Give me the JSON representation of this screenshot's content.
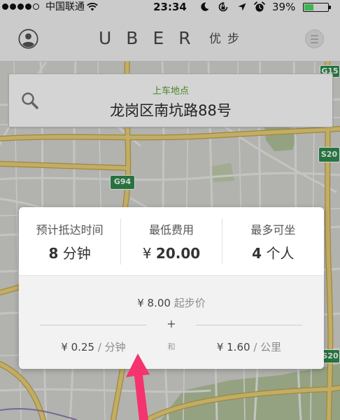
{
  "status_bar": {
    "signal": {
      "filled": 4,
      "total": 5
    },
    "carrier": "中国联通",
    "time": "23:34",
    "battery_text": "39%",
    "battery_level": 0.39,
    "icons": [
      "wifi-icon",
      "moon-icon",
      "rotation-lock-icon",
      "location-arrow-icon",
      "alarm-clock-icon",
      "battery-icon"
    ]
  },
  "nav": {
    "logo": "UBER",
    "logo_cn": "优步",
    "icons": [
      "account-icon",
      "menu-icon"
    ]
  },
  "map": {
    "shields": [
      "G15",
      "S20",
      "G94",
      "S20"
    ]
  },
  "pickup": {
    "label": "上车地点",
    "address": "龙岗区南坑路88号",
    "icon": "search-icon"
  },
  "fare_card": {
    "stats": [
      {
        "label": "预计抵达时间",
        "value": "8",
        "unit": "分钟"
      },
      {
        "label": "最低费用",
        "prefix": "¥",
        "value": "20.00"
      },
      {
        "label": "最多可坐",
        "value": "4",
        "unit": "个人"
      }
    ],
    "base_fare": {
      "amount": "¥ 8.00",
      "label": "起步价"
    },
    "plus": "+",
    "per_minute": {
      "amount": "¥ 0.25",
      "unit": "/ 分钟"
    },
    "and": "和",
    "per_km": {
      "amount": "¥ 1.60",
      "unit": "/ 公里"
    }
  },
  "annotation": {
    "icon": "pink-arrow-icon"
  },
  "colors": {
    "pickup_label": "#5a9f2e",
    "arrow": "#f5336e",
    "battery_fill": "#4cd964",
    "highway_shield": "#2e8b4e",
    "major_road": "#ead17a"
  }
}
